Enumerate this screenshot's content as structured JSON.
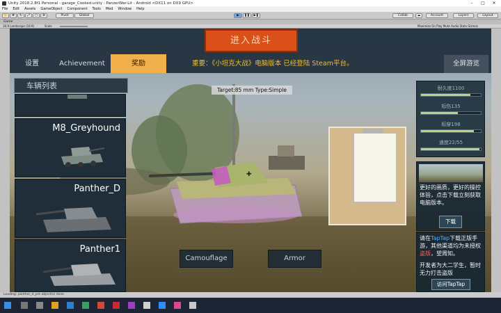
{
  "window": {
    "title": "Unity 2018.2.8f1 Personal - garage_Cooked.unity - PanzerWar-Lit - Android <DX11 on DX9 GPU>",
    "controls": [
      "–",
      "□",
      "✕"
    ]
  },
  "menu": [
    "File",
    "Edit",
    "Assets",
    "GameObject",
    "Component",
    "Tools",
    "Mod",
    "Window",
    "Help"
  ],
  "toolbar": {
    "pivot": "Pivot",
    "global": "Global",
    "collab": "Collab",
    "account": "Account",
    "layers": "Layers",
    "layout": "Layout"
  },
  "game_tab": "Game",
  "game_bar": {
    "aspect": "16:9 Landscape (16:9)",
    "scale_label": "Scale",
    "options": "Maximize On Play   Mute Audio   Stats   Gizmos"
  },
  "status_text": "Loading: panther_d_pre object(s) done",
  "hud": {
    "start_button": "进入战斗",
    "tabs": [
      "设置",
      "Achievement",
      "奖励"
    ],
    "announcement": "重要：《小坦克大战》电脑版本 已经登陆 Steam平台。",
    "fullscreen": "全屏游览"
  },
  "vehicle_list": {
    "title": "车辆列表",
    "items": [
      "M8_Greyhound",
      "Panther_D",
      "Panther1"
    ]
  },
  "target_label": "Target:85 mm Type:Simple",
  "stats": [
    {
      "label": "耐久度1100",
      "fraction": 0.82
    },
    {
      "label": "标伤135",
      "fraction": 0.62
    },
    {
      "label": "标穿198",
      "fraction": 0.88
    },
    {
      "label": "速度22/55",
      "fraction": 0.98
    }
  ],
  "ad": {
    "text": "更好的画质，更好的操控体验，点击下载立刻获取电脑版本。",
    "download": "下载"
  },
  "taptap": {
    "p1a": "请在",
    "p1b": "TapTap",
    "p1c": "下载正版手游，其他渠道均为未授权",
    "p1d": "盗版",
    "p1e": "，望周知。",
    "p2": "开发者为大二学生，暂时无力打击盗版",
    "button": "访问TapTap"
  },
  "bottom_buttons": [
    "Camouflage",
    "Armor"
  ],
  "colors": {
    "start_button": "#d9501a",
    "active_tab": "#f2b04c",
    "announcement": "#f0bc38",
    "stat_fill": "#b9d28b"
  }
}
